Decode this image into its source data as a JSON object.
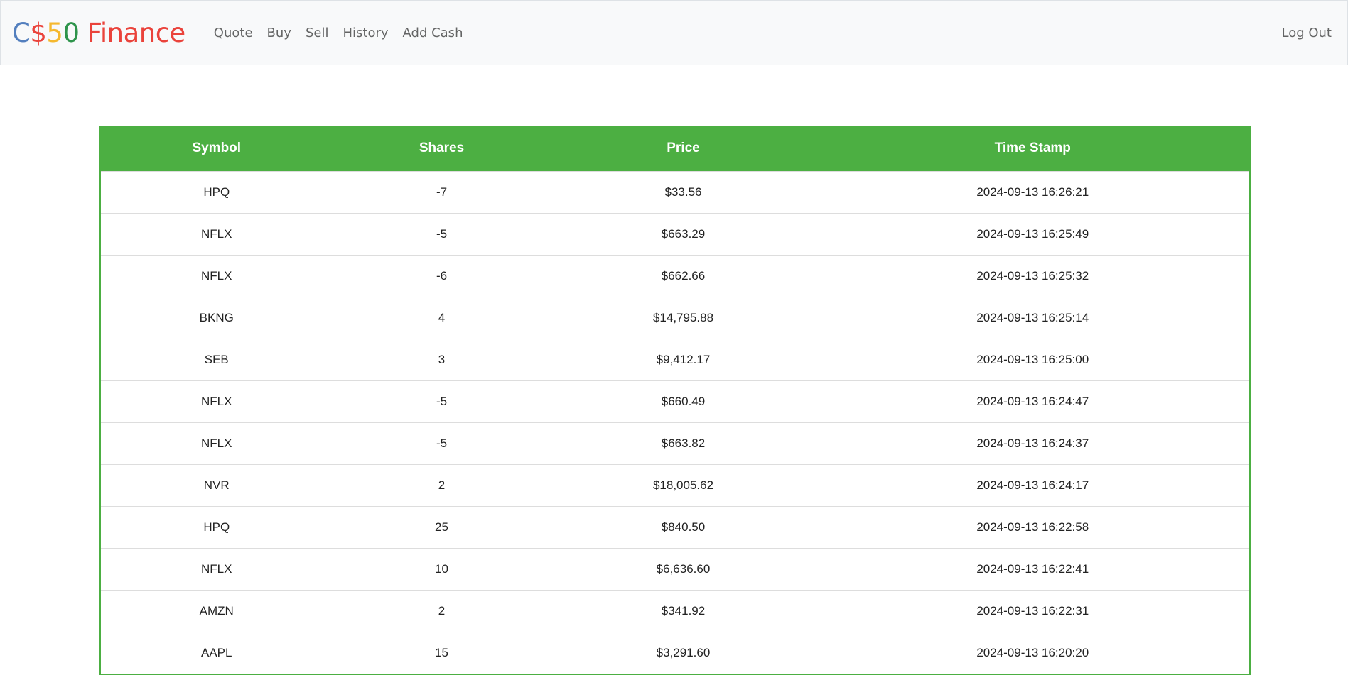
{
  "navbar": {
    "brand": {
      "c": "C",
      "dollar": "$",
      "five": "5",
      "zero": "0",
      "finance": " Finance"
    },
    "links": [
      "Quote",
      "Buy",
      "Sell",
      "History",
      "Add Cash"
    ],
    "logout": "Log Out"
  },
  "colors": {
    "header_bg": "#4caf42",
    "brand_blue": "#537fbe",
    "brand_red": "#ea433b",
    "brand_yellow": "#f5b82e",
    "brand_green": "#2e944b"
  },
  "table": {
    "headers": [
      "Symbol",
      "Shares",
      "Price",
      "Time Stamp"
    ],
    "rows": [
      [
        "HPQ",
        "-7",
        "$33.56",
        "2024-09-13 16:26:21"
      ],
      [
        "NFLX",
        "-5",
        "$663.29",
        "2024-09-13 16:25:49"
      ],
      [
        "NFLX",
        "-6",
        "$662.66",
        "2024-09-13 16:25:32"
      ],
      [
        "BKNG",
        "4",
        "$14,795.88",
        "2024-09-13 16:25:14"
      ],
      [
        "SEB",
        "3",
        "$9,412.17",
        "2024-09-13 16:25:00"
      ],
      [
        "NFLX",
        "-5",
        "$660.49",
        "2024-09-13 16:24:47"
      ],
      [
        "NFLX",
        "-5",
        "$663.82",
        "2024-09-13 16:24:37"
      ],
      [
        "NVR",
        "2",
        "$18,005.62",
        "2024-09-13 16:24:17"
      ],
      [
        "HPQ",
        "25",
        "$840.50",
        "2024-09-13 16:22:58"
      ],
      [
        "NFLX",
        "10",
        "$6,636.60",
        "2024-09-13 16:22:41"
      ],
      [
        "AMZN",
        "2",
        "$341.92",
        "2024-09-13 16:22:31"
      ],
      [
        "AAPL",
        "15",
        "$3,291.60",
        "2024-09-13 16:20:20"
      ]
    ]
  }
}
